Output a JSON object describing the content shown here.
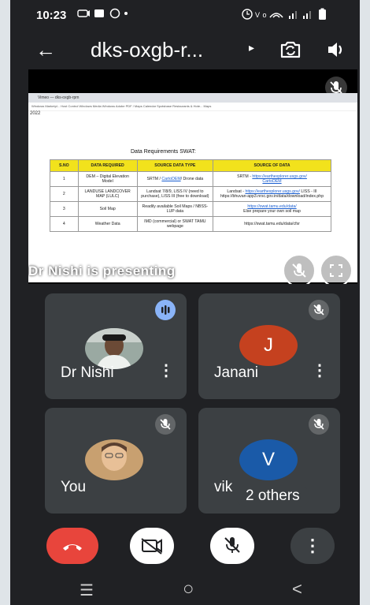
{
  "status_bar": {
    "time": "10:23"
  },
  "header": {
    "back": "←",
    "meeting_code": "dks-oxgb-r...",
    "expand": "▸"
  },
  "presentation": {
    "browser_tab": "Vimeo — dks-oxgb-rpm",
    "bookmarks": "Windows Marketpl...   Host Control   Windows Media   Windows   Adobe PDF / Maps   Calendar   Spotsbase   Restaurants & Hote...   Maps",
    "year_label": "2022",
    "doc_title": "Data Requirements SWAT:",
    "table": {
      "headers": [
        "S.NO",
        "DATA REQUIRED",
        "SOURCE DATA TYPE",
        "SOURCE OF DATA"
      ],
      "rows": [
        {
          "no": "1",
          "data": "DEM – Digital Elevation Model",
          "type_pre": "SRTM / ",
          "type_link": "CartoDEM",
          "type_post": "/ Drone data",
          "source_pre": "SRTM - ",
          "source_link": "https://earthexplorer.usgs.gov/",
          "source_mid": " ",
          "source_link2": "CartoDEM",
          "source_post": ""
        },
        {
          "no": "2",
          "data": "LANDUSE LANDCOVER MAP (LULC)",
          "type_pre": "Landsat 7/8/9, LISS IV (need to purchase), LISS III (free to download)",
          "type_link": "",
          "type_post": "",
          "source_pre": "Landsat - ",
          "source_link": "https://earthexplorer.usgs.gov/",
          "source_mid": " LISS - III https://bhuvan-app3.nrsc.gov.in/data/download/index.php",
          "source_link2": "",
          "source_post": ""
        },
        {
          "no": "3",
          "data": "Soil Map",
          "type_pre": "Readily available Soil Maps / NBSS-LUP data",
          "type_link": "",
          "type_post": "",
          "source_pre": "",
          "source_link": "https://swat.tamu.edu/data/",
          "source_mid": " Else prepare your own soil map",
          "source_link2": "",
          "source_post": ""
        },
        {
          "no": "4",
          "data": "Weather Data",
          "type_pre": "IMD (commercial) or SWAT TAMU webpage",
          "type_link": "",
          "type_post": "",
          "source_pre": "https://swat.tamu.edu/data/cfsr",
          "source_link": "",
          "source_mid": "",
          "source_link2": "",
          "source_post": ""
        }
      ]
    },
    "presenter_label": "Dr Nishi is presenting"
  },
  "participants": [
    {
      "name": "Dr Nishi",
      "kind": "photo",
      "speaking": true,
      "more": "⋮"
    },
    {
      "name": "Janani",
      "kind": "letter",
      "letter": "J",
      "color": "#c5411f",
      "speaking": false,
      "more": "⋮"
    },
    {
      "name": "You",
      "kind": "photo",
      "speaking": false,
      "more": ""
    },
    {
      "name": "vik",
      "kind": "letter",
      "letter": "V",
      "color": "#1a5aa8",
      "speaking": false,
      "more": ""
    }
  ],
  "others_badge": "2 others",
  "controls": {
    "end_call_color": "#e8453c",
    "more": "⋮"
  },
  "navbar": {
    "menu": "☰",
    "home": "○",
    "back": "<"
  },
  "colors": {
    "app_bg": "#202124",
    "tile_bg": "#3c4043",
    "speaking_blue": "#8ab4f8"
  }
}
